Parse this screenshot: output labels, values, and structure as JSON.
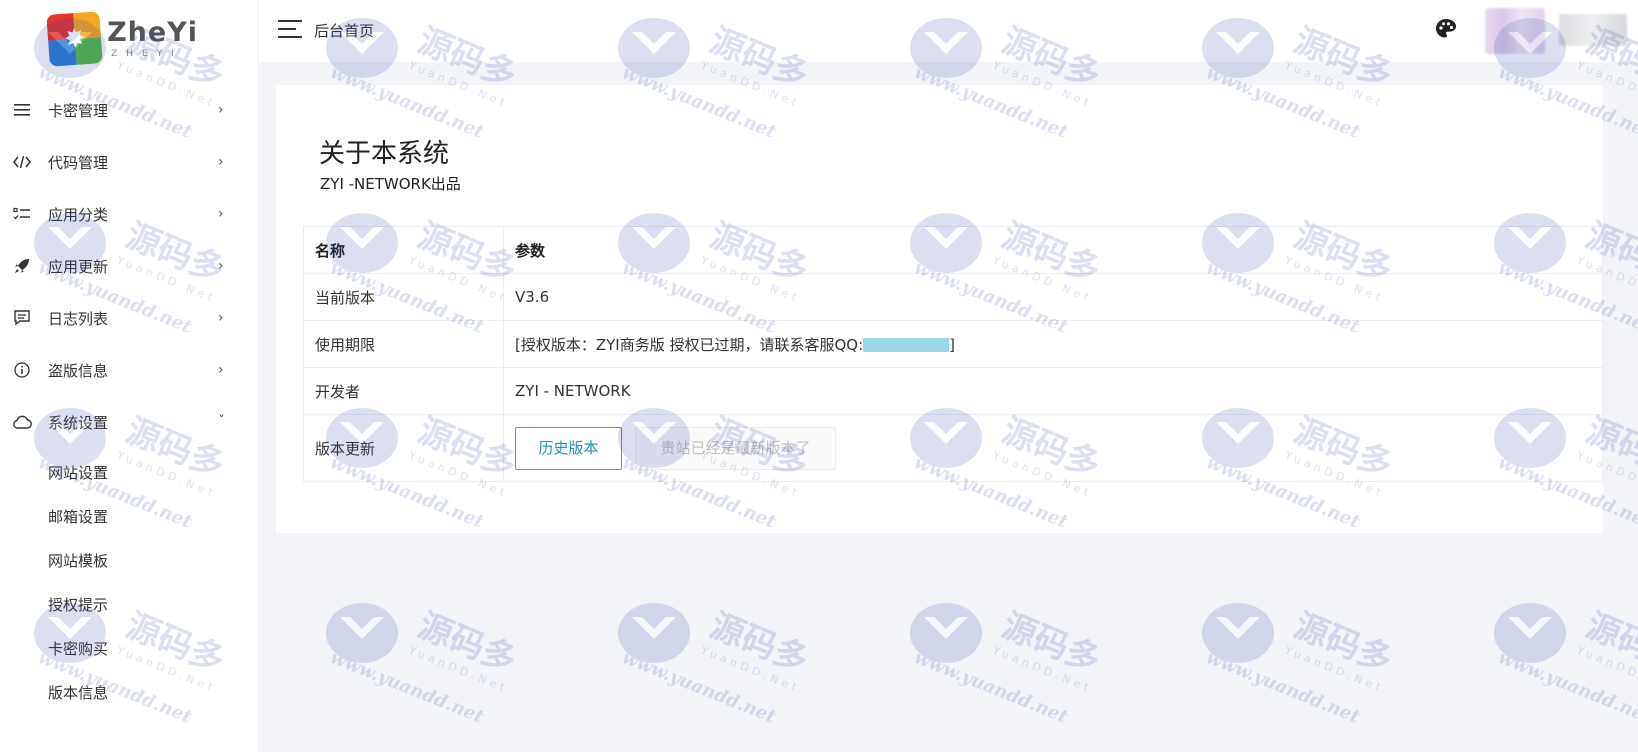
{
  "brand": {
    "name": "ZheYi",
    "subtitle": "ZHEYI"
  },
  "sidebar": {
    "items": [
      {
        "label": "卡密管理",
        "icon": "list-icon",
        "arrow": "›"
      },
      {
        "label": "代码管理",
        "icon": "code-icon",
        "arrow": "›"
      },
      {
        "label": "应用分类",
        "icon": "checklist-icon",
        "arrow": "›"
      },
      {
        "label": "应用更新",
        "icon": "rocket-icon",
        "arrow": "›"
      },
      {
        "label": "日志列表",
        "icon": "comment-icon",
        "arrow": "›"
      },
      {
        "label": "盗版信息",
        "icon": "info-icon",
        "arrow": "›"
      },
      {
        "label": "系统设置",
        "icon": "cloud-icon",
        "arrow": "ˇ"
      }
    ],
    "submenu": [
      {
        "label": "网站设置"
      },
      {
        "label": "邮箱设置"
      },
      {
        "label": "网站模板"
      },
      {
        "label": "授权提示"
      },
      {
        "label": "卡密购买"
      },
      {
        "label": "版本信息"
      }
    ]
  },
  "header": {
    "breadcrumb": "后台首页",
    "menu_icon": "hamburger-icon",
    "theme_icon": "palette-icon"
  },
  "main": {
    "title": "关于本系统",
    "subtitle": "ZYI -NETWORK出品",
    "table": {
      "headers": [
        "名称",
        "参数"
      ],
      "rows": [
        {
          "name": "当前版本",
          "value": "V3.6"
        },
        {
          "name": "使用期限",
          "value_prefix": "[授权版本：ZYI商务版 授权已过期，请联系客服QQ:",
          "value_suffix": "]"
        },
        {
          "name": "开发者",
          "value": "ZYI - NETWORK"
        },
        {
          "name": "版本更新"
        }
      ]
    },
    "buttons": {
      "history": "历史版本",
      "latest": "贵站已经是最新版本了"
    }
  },
  "watermark": {
    "cn": "源码多",
    "en1": "YuanDD.Net",
    "en2": "www.yuandd.net"
  },
  "colors": {
    "accent": "#1e8fb6",
    "background": "#f3f4f8",
    "qq_mask": "#9ad7e8"
  }
}
